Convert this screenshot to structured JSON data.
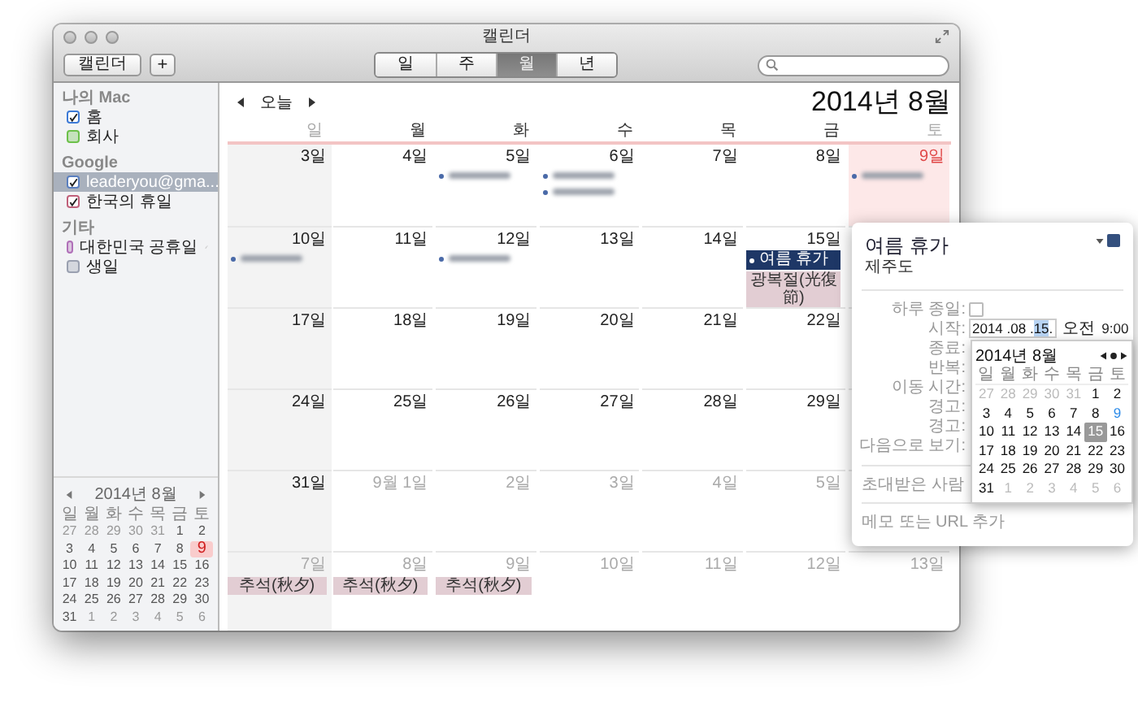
{
  "window": {
    "title": "캘린더"
  },
  "toolbar": {
    "calendars_button": "캘린더",
    "add_button": "+",
    "views": [
      {
        "label": "일",
        "selected": false
      },
      {
        "label": "주",
        "selected": false
      },
      {
        "label": "월",
        "selected": true
      },
      {
        "label": "년",
        "selected": false
      }
    ]
  },
  "sidebar": {
    "groups": [
      {
        "title": "나의 Mac",
        "items": [
          {
            "name": "홈",
            "color": "#3d7ad6",
            "checked": true,
            "selected": false,
            "subscribed": false
          },
          {
            "name": "회사",
            "color": "#6cc04a",
            "checked": false,
            "selected": false,
            "subscribed": false
          }
        ]
      },
      {
        "title": "Google",
        "items": [
          {
            "name": "leaderyou@gma...",
            "color": "#5a7fbf",
            "checked": true,
            "selected": true,
            "subscribed": false
          },
          {
            "name": "한국의 휴일",
            "color": "#c0607a",
            "checked": true,
            "selected": false,
            "subscribed": false
          }
        ]
      },
      {
        "title": "기타",
        "items": [
          {
            "name": "대한민국 공휴일",
            "color": "#b070b8",
            "checked": false,
            "selected": false,
            "subscribed": true
          },
          {
            "name": "생일",
            "color": "#9aa0b0",
            "checked": false,
            "selected": false,
            "subscribed": false
          }
        ]
      }
    ]
  },
  "mini_calendar": {
    "title": "2014년 8월",
    "weekdays": [
      "일",
      "월",
      "화",
      "수",
      "목",
      "금",
      "토"
    ],
    "days": [
      {
        "label": "27",
        "other_month": true,
        "today": false
      },
      {
        "label": "28",
        "other_month": true,
        "today": false
      },
      {
        "label": "29",
        "other_month": true,
        "today": false
      },
      {
        "label": "30",
        "other_month": true,
        "today": false
      },
      {
        "label": "31",
        "other_month": true,
        "today": false
      },
      {
        "label": "1",
        "other_month": false,
        "today": false
      },
      {
        "label": "2",
        "other_month": false,
        "today": false
      },
      {
        "label": "3",
        "other_month": false,
        "today": false
      },
      {
        "label": "4",
        "other_month": false,
        "today": false
      },
      {
        "label": "5",
        "other_month": false,
        "today": false
      },
      {
        "label": "6",
        "other_month": false,
        "today": false
      },
      {
        "label": "7",
        "other_month": false,
        "today": false
      },
      {
        "label": "8",
        "other_month": false,
        "today": false
      },
      {
        "label": "9",
        "other_month": false,
        "today": true
      },
      {
        "label": "10",
        "other_month": false,
        "today": false
      },
      {
        "label": "11",
        "other_month": false,
        "today": false
      },
      {
        "label": "12",
        "other_month": false,
        "today": false
      },
      {
        "label": "13",
        "other_month": false,
        "today": false
      },
      {
        "label": "14",
        "other_month": false,
        "today": false
      },
      {
        "label": "15",
        "other_month": false,
        "today": false
      },
      {
        "label": "16",
        "other_month": false,
        "today": false
      },
      {
        "label": "17",
        "other_month": false,
        "today": false
      },
      {
        "label": "18",
        "other_month": false,
        "today": false
      },
      {
        "label": "19",
        "other_month": false,
        "today": false
      },
      {
        "label": "20",
        "other_month": false,
        "today": false
      },
      {
        "label": "21",
        "other_month": false,
        "today": false
      },
      {
        "label": "22",
        "other_month": false,
        "today": false
      },
      {
        "label": "23",
        "other_month": false,
        "today": false
      },
      {
        "label": "24",
        "other_month": false,
        "today": false
      },
      {
        "label": "25",
        "other_month": false,
        "today": false
      },
      {
        "label": "26",
        "other_month": false,
        "today": false
      },
      {
        "label": "27",
        "other_month": false,
        "today": false
      },
      {
        "label": "28",
        "other_month": false,
        "today": false
      },
      {
        "label": "29",
        "other_month": false,
        "today": false
      },
      {
        "label": "30",
        "other_month": false,
        "today": false
      },
      {
        "label": "31",
        "other_month": false,
        "today": false
      },
      {
        "label": "1",
        "other_month": true,
        "today": false
      },
      {
        "label": "2",
        "other_month": true,
        "today": false
      },
      {
        "label": "3",
        "other_month": true,
        "today": false
      },
      {
        "label": "4",
        "other_month": true,
        "today": false
      },
      {
        "label": "5",
        "other_month": true,
        "today": false
      },
      {
        "label": "6",
        "other_month": true,
        "today": false
      }
    ]
  },
  "nav": {
    "today": "오늘",
    "title": "2014년 8월"
  },
  "calendar": {
    "weekdays": [
      {
        "label": "일",
        "weekend": true
      },
      {
        "label": "월",
        "weekend": false
      },
      {
        "label": "화",
        "weekend": false
      },
      {
        "label": "수",
        "weekend": false
      },
      {
        "label": "목",
        "weekend": false
      },
      {
        "label": "금",
        "weekend": false
      },
      {
        "label": "토",
        "weekend": true
      }
    ],
    "weeks": [
      [
        {
          "label": "3일",
          "other_month": false,
          "today": false
        },
        {
          "label": "4일",
          "other_month": false,
          "today": false
        },
        {
          "label": "5일",
          "other_month": false,
          "today": false,
          "events": [
            {
              "kind": "blurred"
            }
          ]
        },
        {
          "label": "6일",
          "other_month": false,
          "today": false,
          "events": [
            {
              "kind": "blurred"
            },
            {
              "kind": "blurred"
            }
          ]
        },
        {
          "label": "7일",
          "other_month": false,
          "today": false
        },
        {
          "label": "8일",
          "other_month": false,
          "today": false
        },
        {
          "label": "9일",
          "other_month": false,
          "today": true,
          "events": [
            {
              "kind": "blurred"
            }
          ]
        }
      ],
      [
        {
          "label": "10일",
          "other_month": false,
          "today": false,
          "events": [
            {
              "kind": "blurred"
            }
          ]
        },
        {
          "label": "11일",
          "other_month": false,
          "today": false
        },
        {
          "label": "12일",
          "other_month": false,
          "today": false,
          "events": [
            {
              "kind": "blurred"
            }
          ]
        },
        {
          "label": "13일",
          "other_month": false,
          "today": false
        },
        {
          "label": "14일",
          "other_month": false,
          "today": false
        },
        {
          "label": "15일",
          "other_month": false,
          "today": false,
          "events": [
            {
              "kind": "timed",
              "title": "여름 휴가",
              "selected": true
            },
            {
              "kind": "allday",
              "title": "광복절(光復節)"
            }
          ]
        }
      ],
      [
        {
          "label": "17일",
          "other_month": false,
          "today": false
        },
        {
          "label": "18일",
          "other_month": false,
          "today": false
        },
        {
          "label": "19일",
          "other_month": false,
          "today": false
        },
        {
          "label": "20일",
          "other_month": false,
          "today": false
        },
        {
          "label": "21일",
          "other_month": false,
          "today": false
        },
        {
          "label": "22일",
          "other_month": false,
          "today": false
        }
      ],
      [
        {
          "label": "24일",
          "other_month": false,
          "today": false
        },
        {
          "label": "25일",
          "other_month": false,
          "today": false
        },
        {
          "label": "26일",
          "other_month": false,
          "today": false
        },
        {
          "label": "27일",
          "other_month": false,
          "today": false
        },
        {
          "label": "28일",
          "other_month": false,
          "today": false
        },
        {
          "label": "29일",
          "other_month": false,
          "today": false
        }
      ],
      [
        {
          "label": "31일",
          "other_month": false,
          "today": false
        },
        {
          "label": "9월 1일",
          "other_month": true,
          "today": false
        },
        {
          "label": "2일",
          "other_month": true,
          "today": false
        },
        {
          "label": "3일",
          "other_month": true,
          "today": false
        },
        {
          "label": "4일",
          "other_month": true,
          "today": false
        },
        {
          "label": "5일",
          "other_month": true,
          "today": false
        }
      ],
      [
        {
          "label": "7일",
          "other_month": true,
          "today": false,
          "events": [
            {
              "kind": "allday",
              "title": "추석(秋夕)"
            }
          ]
        },
        {
          "label": "8일",
          "other_month": true,
          "today": false,
          "events": [
            {
              "kind": "allday",
              "title": "추석(秋夕)"
            }
          ]
        },
        {
          "label": "9일",
          "other_month": true,
          "today": false,
          "events": [
            {
              "kind": "allday",
              "title": "추석(秋夕)"
            }
          ]
        },
        {
          "label": "10일",
          "other_month": true,
          "today": false
        },
        {
          "label": "11일",
          "other_month": true,
          "today": false
        },
        {
          "label": "12일",
          "other_month": true,
          "today": false
        },
        {
          "label": "13일",
          "other_month": true,
          "today": false
        }
      ]
    ]
  },
  "popover": {
    "title": "여름 휴가",
    "location": "제주도",
    "color": "#34507e",
    "fields": [
      {
        "label": "하루 종일:",
        "kind": "checkbox",
        "checked": false
      },
      {
        "label": "시작:",
        "kind": "datetime",
        "date_prefix": "2014 .08 .",
        "date_selected": "15",
        "date_suffix": ".",
        "ampm": "오전",
        "time": "9:00"
      },
      {
        "label": "종료:",
        "kind": "plain"
      },
      {
        "label": "반복:",
        "kind": "plain"
      },
      {
        "label": "이동 시간:",
        "kind": "plain"
      },
      {
        "label": "경고:",
        "kind": "plain"
      },
      {
        "label": "경고:",
        "kind": "plain"
      },
      {
        "label": "다음으로 보기:",
        "kind": "plain"
      }
    ],
    "invitees": "초대받은 사람",
    "notes": "메모 또는 URL 추가",
    "date_picker": {
      "title": "2014년 8월",
      "weekdays": [
        "일",
        "월",
        "화",
        "수",
        "목",
        "금",
        "토"
      ],
      "days": [
        {
          "label": "27",
          "other_month": true,
          "selected": false,
          "today": false
        },
        {
          "label": "28",
          "other_month": true,
          "selected": false,
          "today": false
        },
        {
          "label": "29",
          "other_month": true,
          "selected": false,
          "today": false
        },
        {
          "label": "30",
          "other_month": true,
          "selected": false,
          "today": false
        },
        {
          "label": "31",
          "other_month": true,
          "selected": false,
          "today": false
        },
        {
          "label": "1",
          "other_month": false,
          "selected": false,
          "today": false
        },
        {
          "label": "2",
          "other_month": false,
          "selected": false,
          "today": false
        },
        {
          "label": "3",
          "other_month": false,
          "selected": false,
          "today": false
        },
        {
          "label": "4",
          "other_month": false,
          "selected": false,
          "today": false
        },
        {
          "label": "5",
          "other_month": false,
          "selected": false,
          "today": false
        },
        {
          "label": "6",
          "other_month": false,
          "selected": false,
          "today": false
        },
        {
          "label": "7",
          "other_month": false,
          "selected": false,
          "today": false
        },
        {
          "label": "8",
          "other_month": false,
          "selected": false,
          "today": false
        },
        {
          "label": "9",
          "other_month": false,
          "selected": false,
          "today": true
        },
        {
          "label": "10",
          "other_month": false,
          "selected": false,
          "today": false
        },
        {
          "label": "11",
          "other_month": false,
          "selected": false,
          "today": false
        },
        {
          "label": "12",
          "other_month": false,
          "selected": false,
          "today": false
        },
        {
          "label": "13",
          "other_month": false,
          "selected": false,
          "today": false
        },
        {
          "label": "14",
          "other_month": false,
          "selected": false,
          "today": false
        },
        {
          "label": "15",
          "other_month": false,
          "selected": true,
          "today": false
        },
        {
          "label": "16",
          "other_month": false,
          "selected": false,
          "today": false
        },
        {
          "label": "17",
          "other_month": false,
          "selected": false,
          "today": false
        },
        {
          "label": "18",
          "other_month": false,
          "selected": false,
          "today": false
        },
        {
          "label": "19",
          "other_month": false,
          "selected": false,
          "today": false
        },
        {
          "label": "20",
          "other_month": false,
          "selected": false,
          "today": false
        },
        {
          "label": "21",
          "other_month": false,
          "selected": false,
          "today": false
        },
        {
          "label": "22",
          "other_month": false,
          "selected": false,
          "today": false
        },
        {
          "label": "23",
          "other_month": false,
          "selected": false,
          "today": false
        },
        {
          "label": "24",
          "other_month": false,
          "selected": false,
          "today": false
        },
        {
          "label": "25",
          "other_month": false,
          "selected": false,
          "today": false
        },
        {
          "label": "26",
          "other_month": false,
          "selected": false,
          "today": false
        },
        {
          "label": "27",
          "other_month": false,
          "selected": false,
          "today": false
        },
        {
          "label": "28",
          "other_month": false,
          "selected": false,
          "today": false
        },
        {
          "label": "29",
          "other_month": false,
          "selected": false,
          "today": false
        },
        {
          "label": "30",
          "other_month": false,
          "selected": false,
          "today": false
        },
        {
          "label": "31",
          "other_month": false,
          "selected": false,
          "today": false
        },
        {
          "label": "1",
          "other_month": true,
          "selected": false,
          "today": false
        },
        {
          "label": "2",
          "other_month": true,
          "selected": false,
          "today": false
        },
        {
          "label": "3",
          "other_month": true,
          "selected": false,
          "today": false
        },
        {
          "label": "4",
          "other_month": true,
          "selected": false,
          "today": false
        },
        {
          "label": "5",
          "other_month": true,
          "selected": false,
          "today": false
        },
        {
          "label": "6",
          "other_month": true,
          "selected": false,
          "today": false
        }
      ]
    }
  }
}
